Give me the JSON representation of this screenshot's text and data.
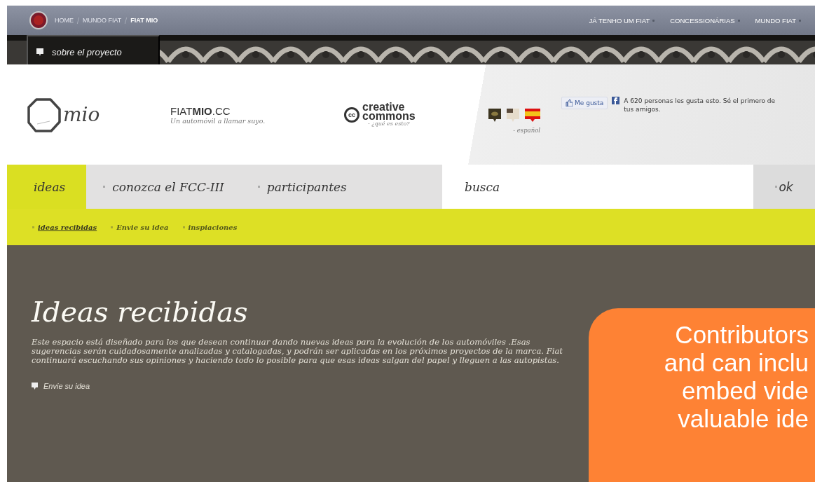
{
  "top_bar": {
    "breadcrumb": [
      {
        "label": "HOME",
        "current": false
      },
      {
        "label": "MUNDO FIAT",
        "current": false
      },
      {
        "label": "FIAT MIO",
        "current": true
      }
    ],
    "links": [
      "JÁ TENHO UM FIAT",
      "CONCESSIONÁRIAS",
      "MUNDO FIAT"
    ]
  },
  "project_tab": {
    "label": "sobre el proyecto"
  },
  "header": {
    "logo_text": "mio",
    "site_name": "FIAT**MIO**.CC",
    "tagline": "Un automóvil a llamar suyo.",
    "cc": {
      "badge": "cc",
      "line1": "creative",
      "line2": "commons",
      "link": "- ¿qué es esto?"
    },
    "language": {
      "label": "- español"
    },
    "like": {
      "button": "Me gusta",
      "text": "A 620 personas les gusta esto. Sé el primero de tus amigos."
    }
  },
  "nav": {
    "tabs": [
      {
        "label": "ideas",
        "selected": true
      },
      {
        "label": "conozca el FCC-III",
        "selected": false
      },
      {
        "label": "participantes",
        "selected": false
      }
    ],
    "search": {
      "placeholder": "busca"
    },
    "ok": "ok"
  },
  "subnav": [
    {
      "label": "ideas recibidas",
      "selected": true
    },
    {
      "label": "Envie su idea",
      "selected": false
    },
    {
      "label": "inspiaciones",
      "selected": false
    }
  ],
  "content": {
    "title": "Ideas recibidas",
    "text": "Este espacio está diseñado para los que desean continuar dando nuevas ideas para la evolución de los automóviles .Esas sugerencias serán cuidadosamente analizadas y catalogadas, y podrán ser aplicadas en los próximos proyectos de la marca. Fiat continuará escuchando sus opiniones y haciendo todo lo posible para que esas ideas salgan del papel y lleguen a las autopistas.",
    "action": "Envie su idea"
  },
  "callout": {
    "lines": [
      "Contributors",
      "and can inclu",
      "embed vide",
      "valuable ide"
    ]
  }
}
